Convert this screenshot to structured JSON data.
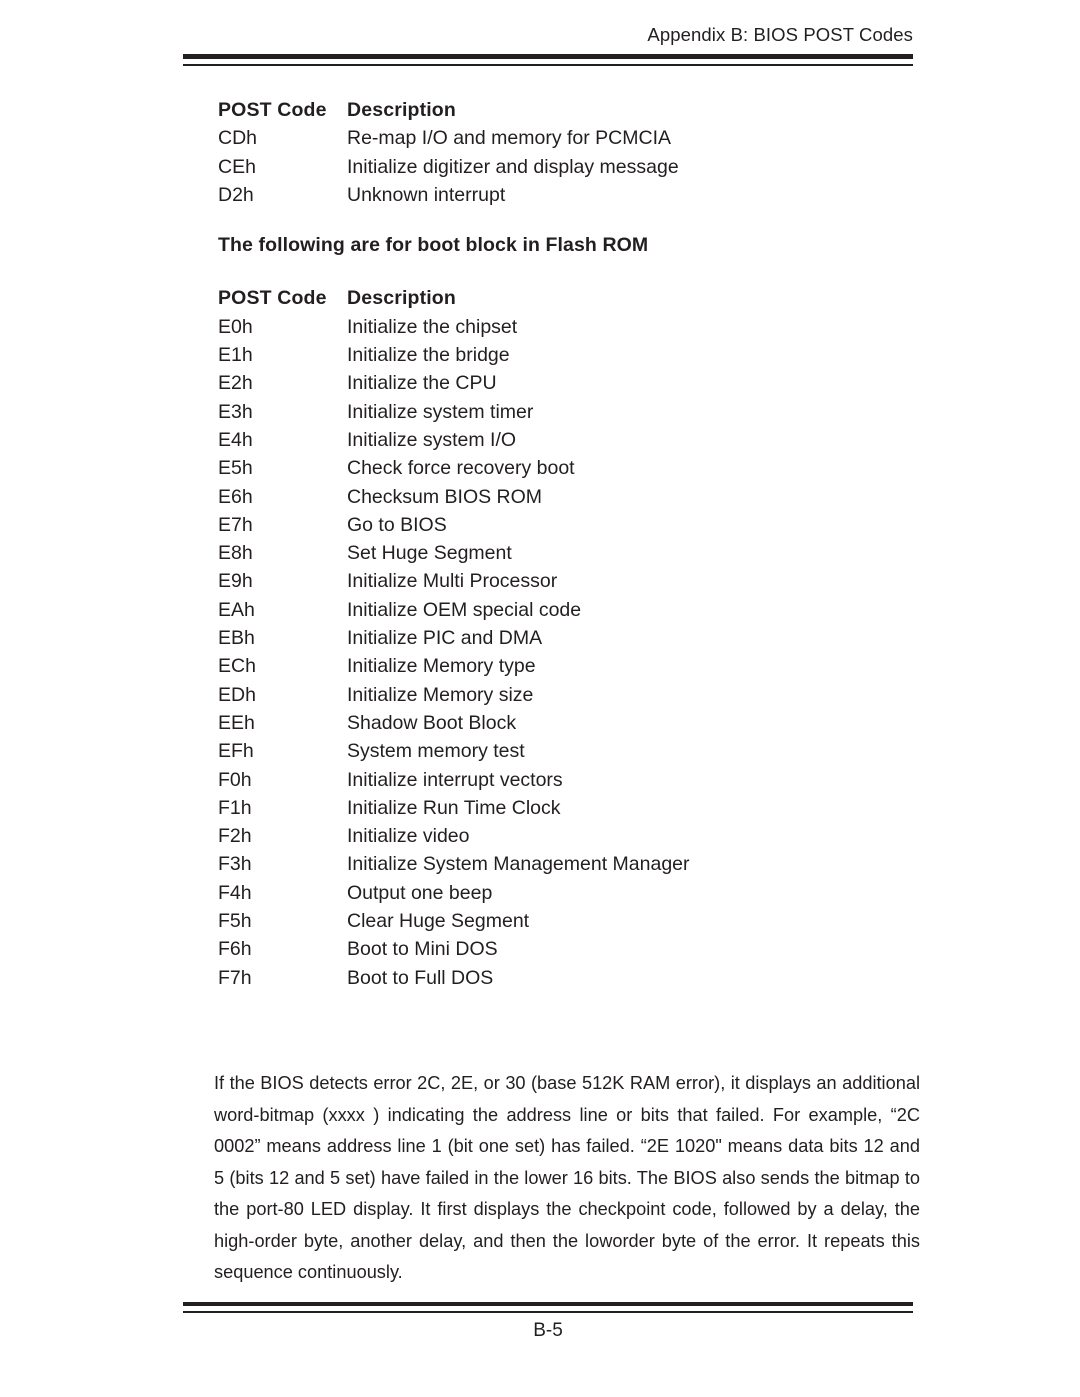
{
  "header": {
    "running_head": "Appendix B: BIOS POST Codes"
  },
  "table_one": {
    "columns": {
      "code": "POST Code",
      "description": "Description"
    },
    "rows": [
      {
        "code": "CDh",
        "description": "Re-map I/O and memory for PCMCIA"
      },
      {
        "code": "CEh",
        "description": "Initialize digitizer and display message"
      },
      {
        "code": "D2h",
        "description": "Unknown interrupt"
      }
    ]
  },
  "section_heading": "The following are for boot block in Flash ROM",
  "table_two": {
    "columns": {
      "code": "POST Code",
      "description": "Description"
    },
    "rows": [
      {
        "code": "E0h",
        "description": "Initialize the chipset"
      },
      {
        "code": "E1h",
        "description": "Initialize the bridge"
      },
      {
        "code": "E2h",
        "description": "Initialize the CPU"
      },
      {
        "code": "E3h",
        "description": "Initialize system timer"
      },
      {
        "code": "E4h",
        "description": "Initialize system I/O"
      },
      {
        "code": "E5h",
        "description": "Check force recovery boot"
      },
      {
        "code": "E6h",
        "description": "Checksum BIOS ROM"
      },
      {
        "code": "E7h",
        "description": "Go to BIOS"
      },
      {
        "code": "E8h",
        "description": "Set Huge Segment"
      },
      {
        "code": "E9h",
        "description": "Initialize Multi Processor"
      },
      {
        "code": "EAh",
        "description": "Initialize OEM special code"
      },
      {
        "code": "EBh",
        "description": "Initialize PIC and DMA"
      },
      {
        "code": "ECh",
        "description": "Initialize Memory type"
      },
      {
        "code": "EDh",
        "description": "Initialize Memory size"
      },
      {
        "code": "EEh",
        "description": "Shadow Boot Block"
      },
      {
        "code": "EFh",
        "description": "System memory test"
      },
      {
        "code": "F0h",
        "description": "Initialize interrupt vectors"
      },
      {
        "code": "F1h",
        "description": "Initialize Run Time Clock"
      },
      {
        "code": "F2h",
        "description": "Initialize video"
      },
      {
        "code": "F3h",
        "description": "Initialize System Management Manager"
      },
      {
        "code": "F4h",
        "description": "Output one beep"
      },
      {
        "code": "F5h",
        "description": "Clear Huge Segment"
      },
      {
        "code": "F6h",
        "description": "Boot to Mini DOS"
      },
      {
        "code": "F7h",
        "description": "Boot to Full DOS"
      }
    ]
  },
  "note": {
    "text": "If the BIOS detects error 2C, 2E, or 30 (base 512K RAM error), it displays an additional word-bitmap (xxxx ) indicating the address line or bits that failed.  For example, “2C 0002” means address line 1 (bit one set) has failed.  “2E 1020\" means data bits 12 and 5 (bits 12 and 5 set) have failed in the lower 16 bits.  The BIOS also sends the bitmap to the port-80 LED display.  It first displays the checkpoint code, followed by a delay, the high-order byte, another delay, and then the loworder byte of the error.  It repeats this sequence continuously."
  },
  "footer": {
    "page_number": "B-5"
  }
}
